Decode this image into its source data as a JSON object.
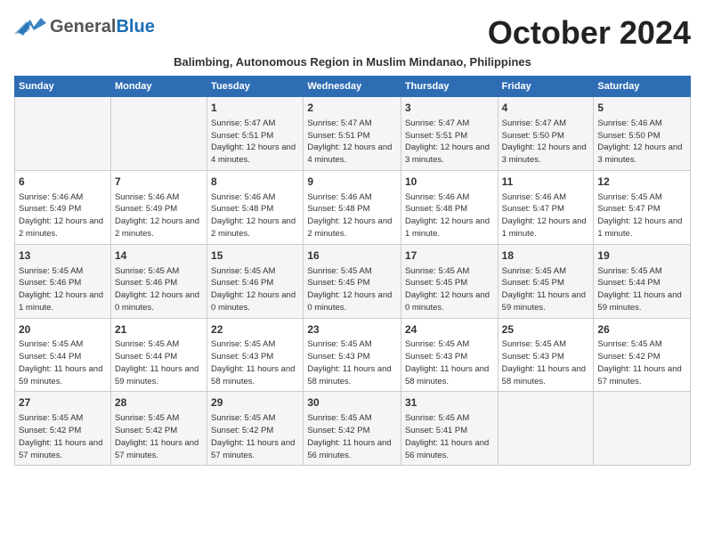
{
  "header": {
    "logo_general": "General",
    "logo_blue": "Blue",
    "month_title": "October 2024",
    "subtitle": "Balimbing, Autonomous Region in Muslim Mindanao, Philippines"
  },
  "days_of_week": [
    "Sunday",
    "Monday",
    "Tuesday",
    "Wednesday",
    "Thursday",
    "Friday",
    "Saturday"
  ],
  "weeks": [
    [
      {
        "day": "",
        "info": ""
      },
      {
        "day": "",
        "info": ""
      },
      {
        "day": "1",
        "info": "Sunrise: 5:47 AM\nSunset: 5:51 PM\nDaylight: 12 hours and 4 minutes."
      },
      {
        "day": "2",
        "info": "Sunrise: 5:47 AM\nSunset: 5:51 PM\nDaylight: 12 hours and 4 minutes."
      },
      {
        "day": "3",
        "info": "Sunrise: 5:47 AM\nSunset: 5:51 PM\nDaylight: 12 hours and 3 minutes."
      },
      {
        "day": "4",
        "info": "Sunrise: 5:47 AM\nSunset: 5:50 PM\nDaylight: 12 hours and 3 minutes."
      },
      {
        "day": "5",
        "info": "Sunrise: 5:46 AM\nSunset: 5:50 PM\nDaylight: 12 hours and 3 minutes."
      }
    ],
    [
      {
        "day": "6",
        "info": "Sunrise: 5:46 AM\nSunset: 5:49 PM\nDaylight: 12 hours and 2 minutes."
      },
      {
        "day": "7",
        "info": "Sunrise: 5:46 AM\nSunset: 5:49 PM\nDaylight: 12 hours and 2 minutes."
      },
      {
        "day": "8",
        "info": "Sunrise: 5:46 AM\nSunset: 5:48 PM\nDaylight: 12 hours and 2 minutes."
      },
      {
        "day": "9",
        "info": "Sunrise: 5:46 AM\nSunset: 5:48 PM\nDaylight: 12 hours and 2 minutes."
      },
      {
        "day": "10",
        "info": "Sunrise: 5:46 AM\nSunset: 5:48 PM\nDaylight: 12 hours and 1 minute."
      },
      {
        "day": "11",
        "info": "Sunrise: 5:46 AM\nSunset: 5:47 PM\nDaylight: 12 hours and 1 minute."
      },
      {
        "day": "12",
        "info": "Sunrise: 5:45 AM\nSunset: 5:47 PM\nDaylight: 12 hours and 1 minute."
      }
    ],
    [
      {
        "day": "13",
        "info": "Sunrise: 5:45 AM\nSunset: 5:46 PM\nDaylight: 12 hours and 1 minute."
      },
      {
        "day": "14",
        "info": "Sunrise: 5:45 AM\nSunset: 5:46 PM\nDaylight: 12 hours and 0 minutes."
      },
      {
        "day": "15",
        "info": "Sunrise: 5:45 AM\nSunset: 5:46 PM\nDaylight: 12 hours and 0 minutes."
      },
      {
        "day": "16",
        "info": "Sunrise: 5:45 AM\nSunset: 5:45 PM\nDaylight: 12 hours and 0 minutes."
      },
      {
        "day": "17",
        "info": "Sunrise: 5:45 AM\nSunset: 5:45 PM\nDaylight: 12 hours and 0 minutes."
      },
      {
        "day": "18",
        "info": "Sunrise: 5:45 AM\nSunset: 5:45 PM\nDaylight: 11 hours and 59 minutes."
      },
      {
        "day": "19",
        "info": "Sunrise: 5:45 AM\nSunset: 5:44 PM\nDaylight: 11 hours and 59 minutes."
      }
    ],
    [
      {
        "day": "20",
        "info": "Sunrise: 5:45 AM\nSunset: 5:44 PM\nDaylight: 11 hours and 59 minutes."
      },
      {
        "day": "21",
        "info": "Sunrise: 5:45 AM\nSunset: 5:44 PM\nDaylight: 11 hours and 59 minutes."
      },
      {
        "day": "22",
        "info": "Sunrise: 5:45 AM\nSunset: 5:43 PM\nDaylight: 11 hours and 58 minutes."
      },
      {
        "day": "23",
        "info": "Sunrise: 5:45 AM\nSunset: 5:43 PM\nDaylight: 11 hours and 58 minutes."
      },
      {
        "day": "24",
        "info": "Sunrise: 5:45 AM\nSunset: 5:43 PM\nDaylight: 11 hours and 58 minutes."
      },
      {
        "day": "25",
        "info": "Sunrise: 5:45 AM\nSunset: 5:43 PM\nDaylight: 11 hours and 58 minutes."
      },
      {
        "day": "26",
        "info": "Sunrise: 5:45 AM\nSunset: 5:42 PM\nDaylight: 11 hours and 57 minutes."
      }
    ],
    [
      {
        "day": "27",
        "info": "Sunrise: 5:45 AM\nSunset: 5:42 PM\nDaylight: 11 hours and 57 minutes."
      },
      {
        "day": "28",
        "info": "Sunrise: 5:45 AM\nSunset: 5:42 PM\nDaylight: 11 hours and 57 minutes."
      },
      {
        "day": "29",
        "info": "Sunrise: 5:45 AM\nSunset: 5:42 PM\nDaylight: 11 hours and 57 minutes."
      },
      {
        "day": "30",
        "info": "Sunrise: 5:45 AM\nSunset: 5:42 PM\nDaylight: 11 hours and 56 minutes."
      },
      {
        "day": "31",
        "info": "Sunrise: 5:45 AM\nSunset: 5:41 PM\nDaylight: 11 hours and 56 minutes."
      },
      {
        "day": "",
        "info": ""
      },
      {
        "day": "",
        "info": ""
      }
    ]
  ]
}
